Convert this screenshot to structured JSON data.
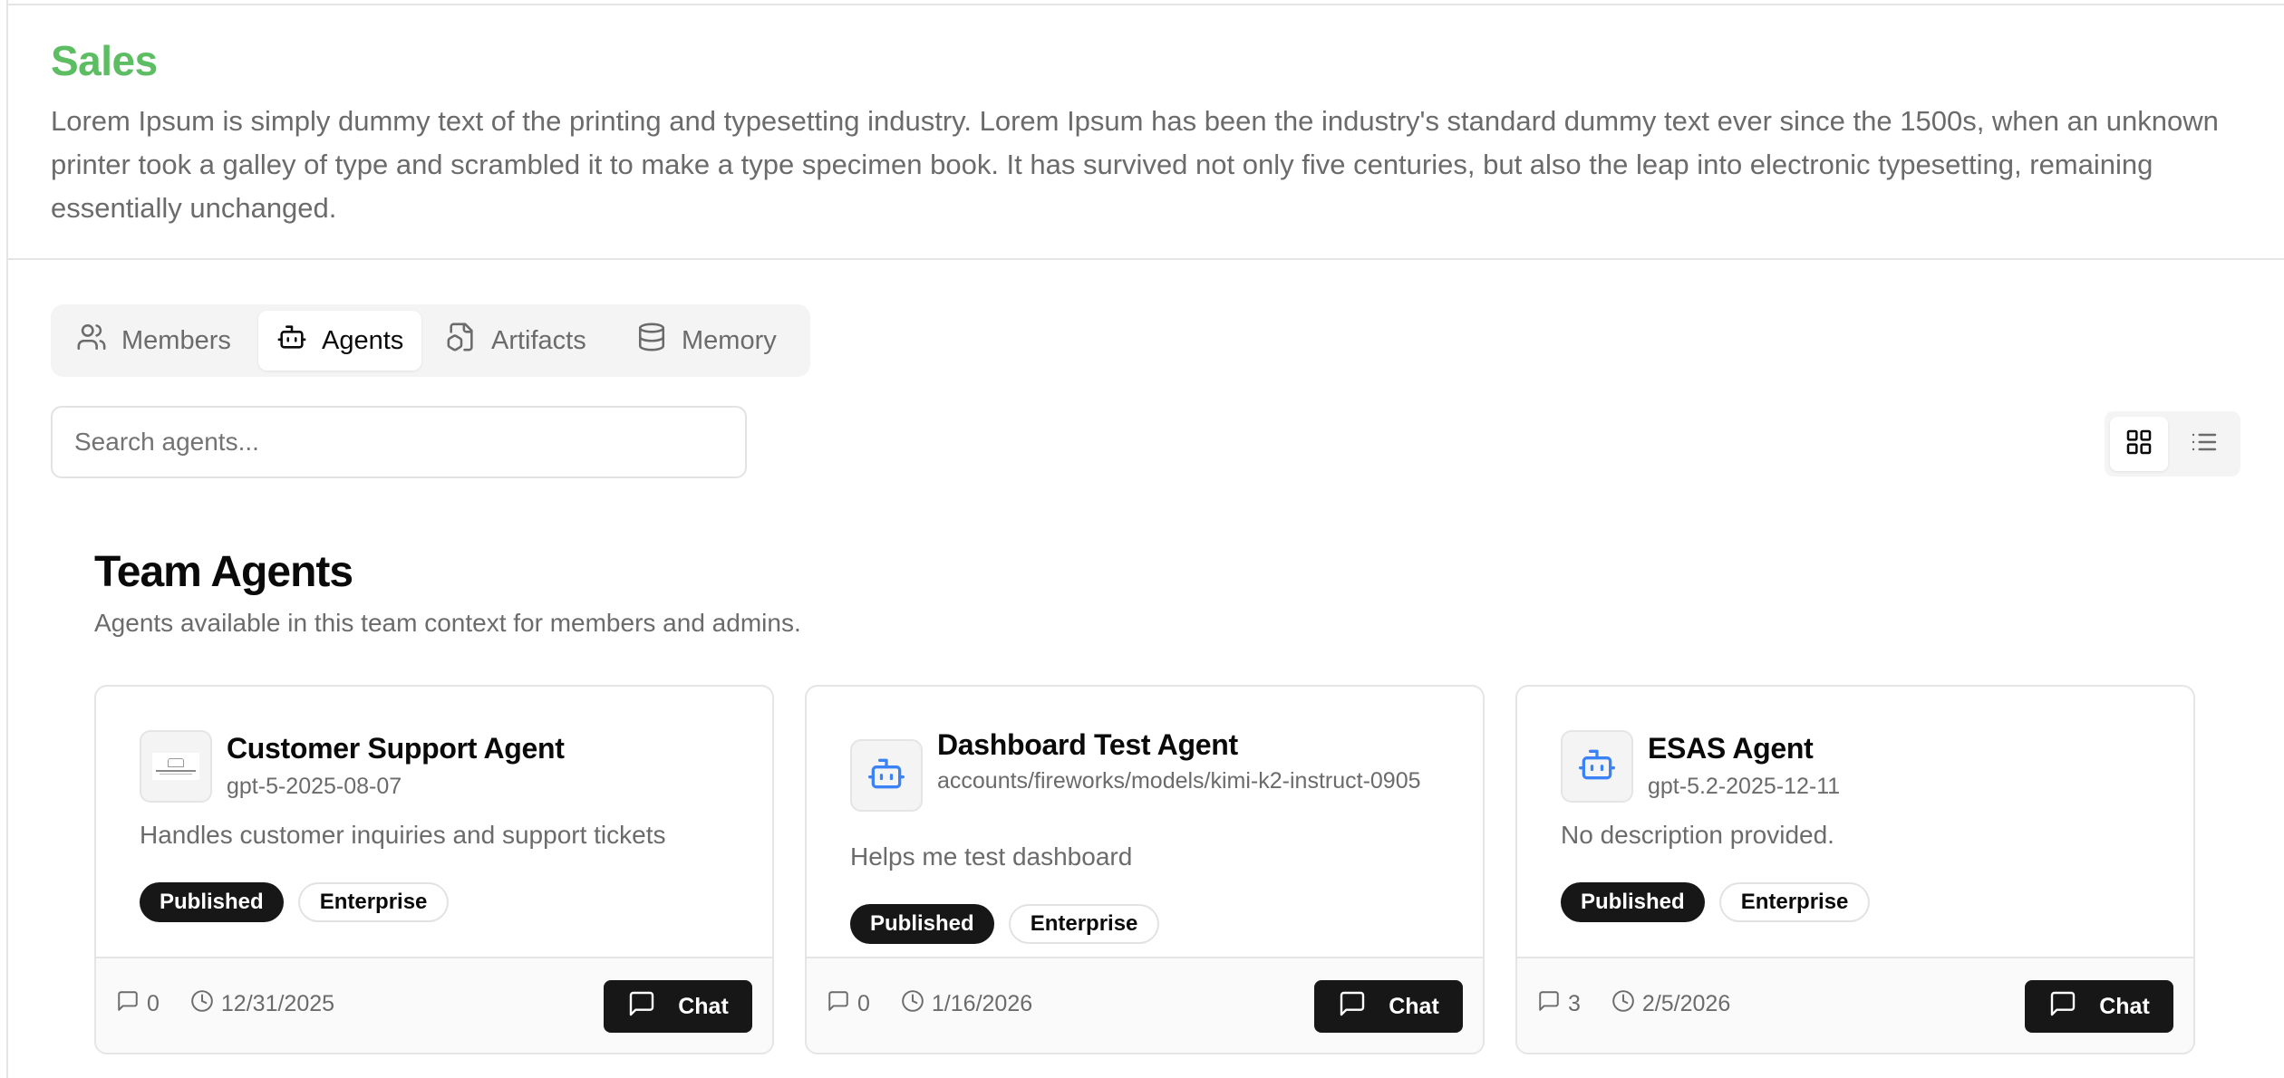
{
  "header": {
    "title": "Sales",
    "description": "Lorem Ipsum is simply dummy text of the printing and typesetting industry. Lorem Ipsum has been the industry's standard dummy text ever since the 1500s, when an unknown printer took a galley of type and scrambled it to make a type specimen book. It has survived not only five centuries, but also the leap into electronic typesetting, remaining essentially unchanged.",
    "title_color": "#5cbd62"
  },
  "tabs": [
    {
      "label": "Members",
      "icon": "users-icon",
      "active": false
    },
    {
      "label": "Agents",
      "icon": "bot-icon",
      "active": true
    },
    {
      "label": "Artifacts",
      "icon": "file-box-icon",
      "active": false
    },
    {
      "label": "Memory",
      "icon": "database-icon",
      "active": false
    }
  ],
  "search": {
    "placeholder": "Search agents...",
    "value": ""
  },
  "view_toggle": {
    "options": [
      "grid-icon",
      "list-icon"
    ],
    "selected": "grid"
  },
  "section": {
    "title": "Team Agents",
    "subtitle": "Agents available in this team context for members and admins."
  },
  "agents": [
    {
      "name": "Customer Support Agent",
      "model": "gpt-5-2025-08-07",
      "description": "Handles customer inquiries and support tickets",
      "avatar": "logo-image",
      "badges": [
        "Published",
        "Enterprise"
      ],
      "chats": "0",
      "date": "12/31/2025",
      "chat_label": "Chat"
    },
    {
      "name": "Dashboard Test Agent",
      "model": "accounts/fireworks/models/kimi-k2-instruct-0905",
      "description": "Helps me test dashboard",
      "avatar": "bot-icon",
      "badges": [
        "Published",
        "Enterprise"
      ],
      "chats": "0",
      "date": "1/16/2026",
      "chat_label": "Chat"
    },
    {
      "name": "ESAS Agent",
      "model": "gpt-5.2-2025-12-11",
      "description": "No description provided.",
      "avatar": "bot-icon",
      "badges": [
        "Published",
        "Enterprise"
      ],
      "chats": "3",
      "date": "2/5/2026",
      "chat_label": "Chat"
    }
  ],
  "colors": {
    "accent_icon": "#3b82f6",
    "badge_dark": "#171717"
  }
}
